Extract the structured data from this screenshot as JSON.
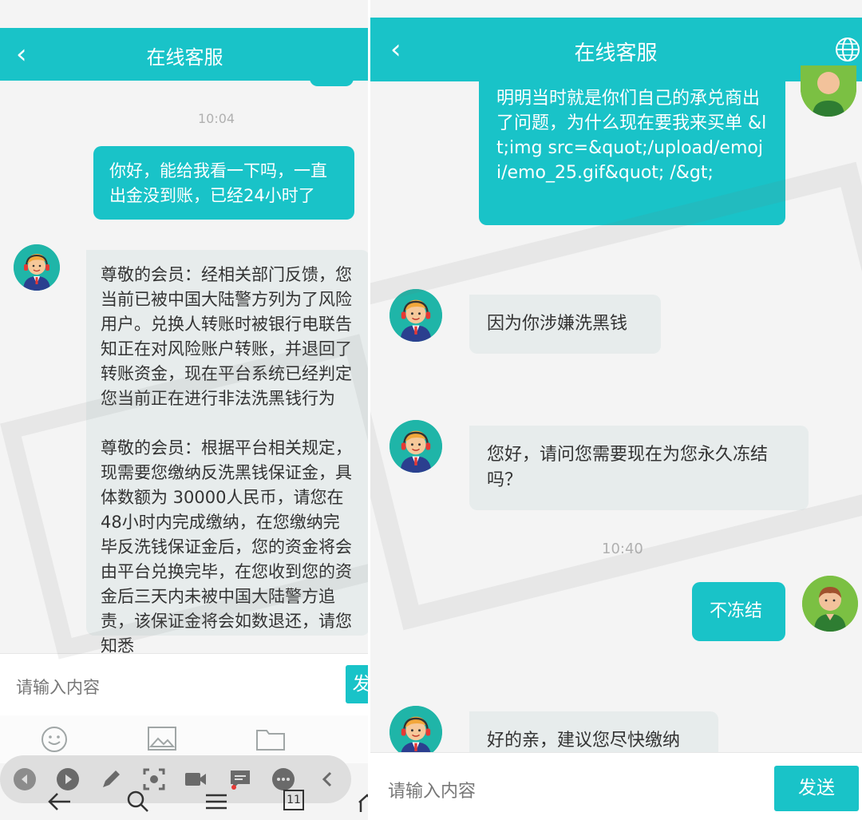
{
  "left": {
    "header": {
      "title": "在线客服"
    },
    "messages": [
      {
        "time": "10:04"
      },
      {
        "from": "user",
        "text": "你好，能给我看一下吗，一直出金没到账，已经24小时了"
      },
      {
        "from": "agent",
        "text": "尊敬的会员：经相关部门反馈，您当前已被中国大陆警方列为了风险用户。兑换人转账时被银行电联告知正在对风险账户转账，并退回了转账资金，现在平台系统已经判定您当前正在进行非法洗黑钱行为"
      },
      {
        "from": "agent",
        "text": "尊敬的会员：根据平台相关规定，现需要您缴纳反洗黑钱保证金，具体数额为 30000人民币，请您在48小时内完成缴纳，在您缴纳完毕反洗钱保证金后，您的资金将会由平台兑换完毕，在您收到您的资金后三天内未被中国大陆警方追责，该保证金将会如数退还，请您知悉"
      }
    ],
    "input": {
      "placeholder": "请输入内容",
      "send": "发"
    },
    "tools": [
      "emoji-icon",
      "image-icon",
      "folder-icon"
    ],
    "floatbar": [
      "back-circle-icon",
      "play-circle-icon",
      "pen-icon",
      "screenshot-icon",
      "video-icon",
      "message-icon",
      "more-icon",
      "collapse-icon"
    ],
    "nav": {
      "tab_count": "11"
    }
  },
  "right": {
    "header": {
      "title": "在线客服"
    },
    "messages": [
      {
        "from": "user",
        "text": "明明当时就是你们自己的承兑商出了问题，为什么现在要我来买单 &lt;img src=&quot;/upload/emoji/emo_25.gif&quot; /&gt;"
      },
      {
        "from": "agent",
        "text": "因为你涉嫌洗黑钱"
      },
      {
        "from": "agent",
        "text": "您好，请问您需要现在为您永久冻结吗？"
      },
      {
        "time": "10:40"
      },
      {
        "from": "user",
        "text": "不冻结"
      },
      {
        "from": "agent",
        "text": "好的亲，建议您尽快缴纳"
      }
    ],
    "input": {
      "placeholder": "请输入内容",
      "send": "发送"
    }
  },
  "colors": {
    "accent": "#19c3c8",
    "bubble_in": "#e7ecec",
    "background": "#f4f4f4"
  }
}
